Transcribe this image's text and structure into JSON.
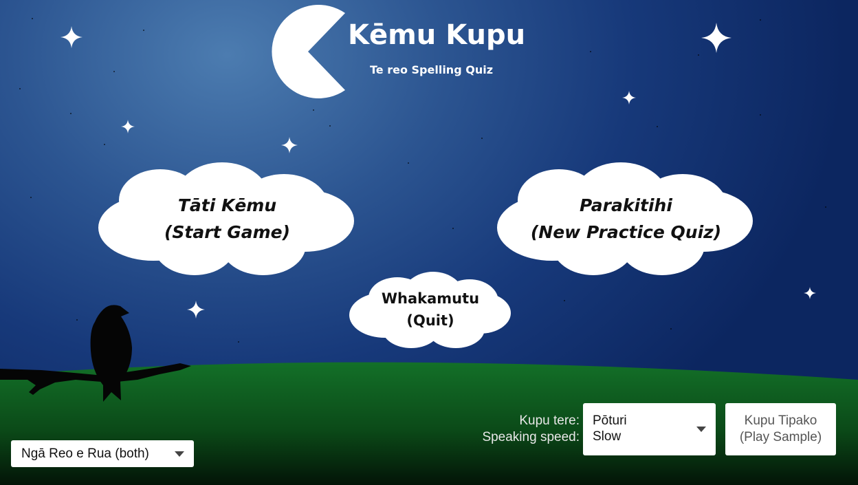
{
  "header": {
    "title": "Kēmu Kupu",
    "subtitle": "Te reo Spelling Quiz"
  },
  "menu": {
    "start": {
      "line1": "Tāti Kēmu",
      "line2": "(Start Game)"
    },
    "practice": {
      "line1": "Parakitihi",
      "line2": "(New Practice Quiz)"
    },
    "quit": {
      "line1": "Whakamutu",
      "line2": "(Quit)"
    }
  },
  "language_select": {
    "value": "Ngā Reo e Rua (both)"
  },
  "speaking_speed": {
    "label_line1": "Kupu tere:",
    "label_line2": "Speaking speed:",
    "value_line1": "Pōturi",
    "value_line2": "Slow"
  },
  "sample_button": {
    "line1": "Kupu Tipako",
    "line2": "(Play Sample)"
  },
  "colors": {
    "sky_top": "#4c7cb0",
    "sky_bottom": "#0c2660",
    "grass": "#0f5e1f",
    "cloud": "#ffffff",
    "moon": "#ffffff"
  },
  "icons": {
    "moon": "pacman-moon-icon",
    "bird": "bird-silhouette-icon",
    "star": "sparkle-star-icon",
    "dropdown": "caret-down-icon"
  }
}
